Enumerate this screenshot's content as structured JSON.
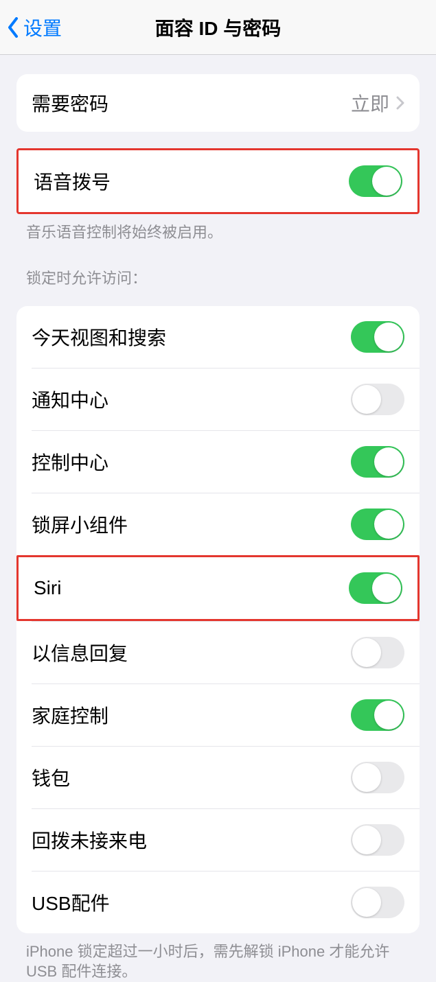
{
  "nav": {
    "back": "设置",
    "title": "面容 ID 与密码"
  },
  "requirePasscode": {
    "label": "需要密码",
    "value": "立即"
  },
  "voiceDial": {
    "label": "语音拨号",
    "footer": "音乐语音控制将始终被启用。"
  },
  "lockedAccess": {
    "header": "锁定时允许访问：",
    "items": [
      {
        "label": "今天视图和搜索",
        "on": true
      },
      {
        "label": "通知中心",
        "on": false
      },
      {
        "label": "控制中心",
        "on": true
      },
      {
        "label": "锁屏小组件",
        "on": true
      },
      {
        "label": "Siri",
        "on": true
      },
      {
        "label": "以信息回复",
        "on": false
      },
      {
        "label": "家庭控制",
        "on": true
      },
      {
        "label": "钱包",
        "on": false
      },
      {
        "label": "回拨未接来电",
        "on": false
      },
      {
        "label": "USB配件",
        "on": false
      }
    ],
    "footer": "iPhone 锁定超过一小时后，需先解锁 iPhone 才能允许 USB 配件连接。"
  }
}
